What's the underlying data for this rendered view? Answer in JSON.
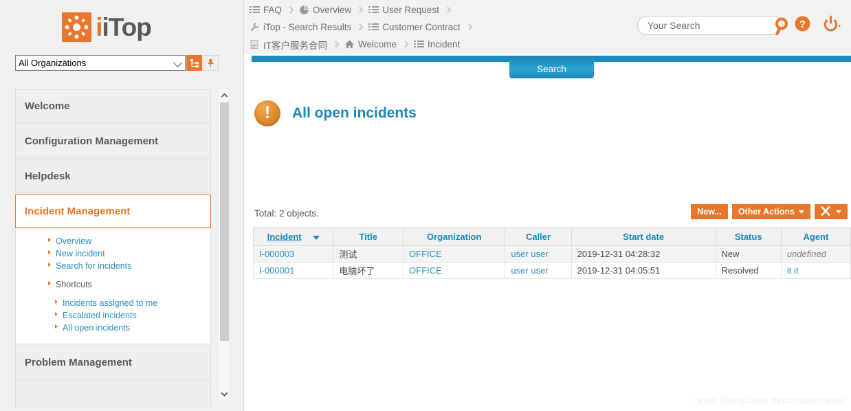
{
  "brand": {
    "logo_text": "iTop",
    "logo_icon": "itop-logo-icon",
    "accent": "#e8762c",
    "link_blue": "#2a8fc0",
    "title_blue": "#1b87b8"
  },
  "org_selector": {
    "value": "All Organizations",
    "tree_button_icon": "hierarchy-icon",
    "pin_button_icon": "pin-icon"
  },
  "sidebar": {
    "groups": [
      {
        "label": "Welcome",
        "active": false
      },
      {
        "label": "Configuration Management",
        "active": false
      },
      {
        "label": "Helpdesk",
        "active": false
      },
      {
        "label": "Incident Management",
        "active": true
      },
      {
        "label": "Problem Management",
        "active": false
      }
    ],
    "submenu": [
      {
        "label": "Overview",
        "link": true,
        "level": 1
      },
      {
        "label": "New incident",
        "link": true,
        "level": 1
      },
      {
        "label": "Search for incidents",
        "link": true,
        "level": 1
      },
      {
        "label": "Shortcuts",
        "link": false,
        "level": 1
      },
      {
        "label": "Incidents assigned to me",
        "link": true,
        "level": 2
      },
      {
        "label": "Escalated incidents",
        "link": true,
        "level": 2
      },
      {
        "label": "All open incidents",
        "link": true,
        "level": 2
      }
    ]
  },
  "breadcrumbs": {
    "rows": [
      [
        {
          "icon": "list-icon",
          "label": "FAQ"
        },
        {
          "icon": "pie-chart-icon",
          "label": "Overview"
        },
        {
          "icon": "list-icon",
          "label": "User Request"
        }
      ],
      [
        {
          "icon": "wrench-icon",
          "label": "iTop - Search Results"
        },
        {
          "icon": "list-icon",
          "label": "Customer Contract"
        }
      ],
      [
        {
          "icon": "document-icon",
          "label": "IT客户服务合同"
        },
        {
          "icon": "home-icon",
          "label": "Welcome"
        },
        {
          "icon": "list-icon",
          "label": "Incident"
        }
      ]
    ]
  },
  "header": {
    "search_placeholder": "Your Search",
    "search_value": "",
    "search_icon": "magnifier-icon",
    "help_icon": "help-circle-icon",
    "power_icon": "power-icon"
  },
  "content": {
    "active_tab": "Search",
    "page_title": "All open incidents",
    "page_title_icon": "warning-icon",
    "total_label": "Total: 2 objects.",
    "toolbar": {
      "new_label": "New...",
      "other_actions_label": "Other Actions",
      "tools_icon": "tools-icon"
    },
    "table": {
      "columns": [
        {
          "label": "Incident",
          "sorted": true,
          "sort_dir": "desc"
        },
        {
          "label": "Title",
          "sorted": false
        },
        {
          "label": "Organization",
          "sorted": false
        },
        {
          "label": "Caller",
          "sorted": false
        },
        {
          "label": "Start date",
          "sorted": false
        },
        {
          "label": "Status",
          "sorted": false
        },
        {
          "label": "Agent",
          "sorted": false
        }
      ],
      "rows": [
        {
          "incident": "I-000003",
          "title": "测试",
          "organization": "OFFICE",
          "caller": "user user",
          "start_date": "2019-12-31 04:28:32",
          "status": "New",
          "agent": "undefined",
          "agent_undefined": true
        },
        {
          "incident": "I-000001",
          "title": "电脑坏了",
          "organization": "OFFICE",
          "caller": "user user",
          "start_date": "2019-12-31 04:05:51",
          "status": "Resolved",
          "agent": "it it",
          "agent_undefined": false
        }
      ]
    }
  },
  "watermark": "https://blog.csdn.net/chscomfaner"
}
